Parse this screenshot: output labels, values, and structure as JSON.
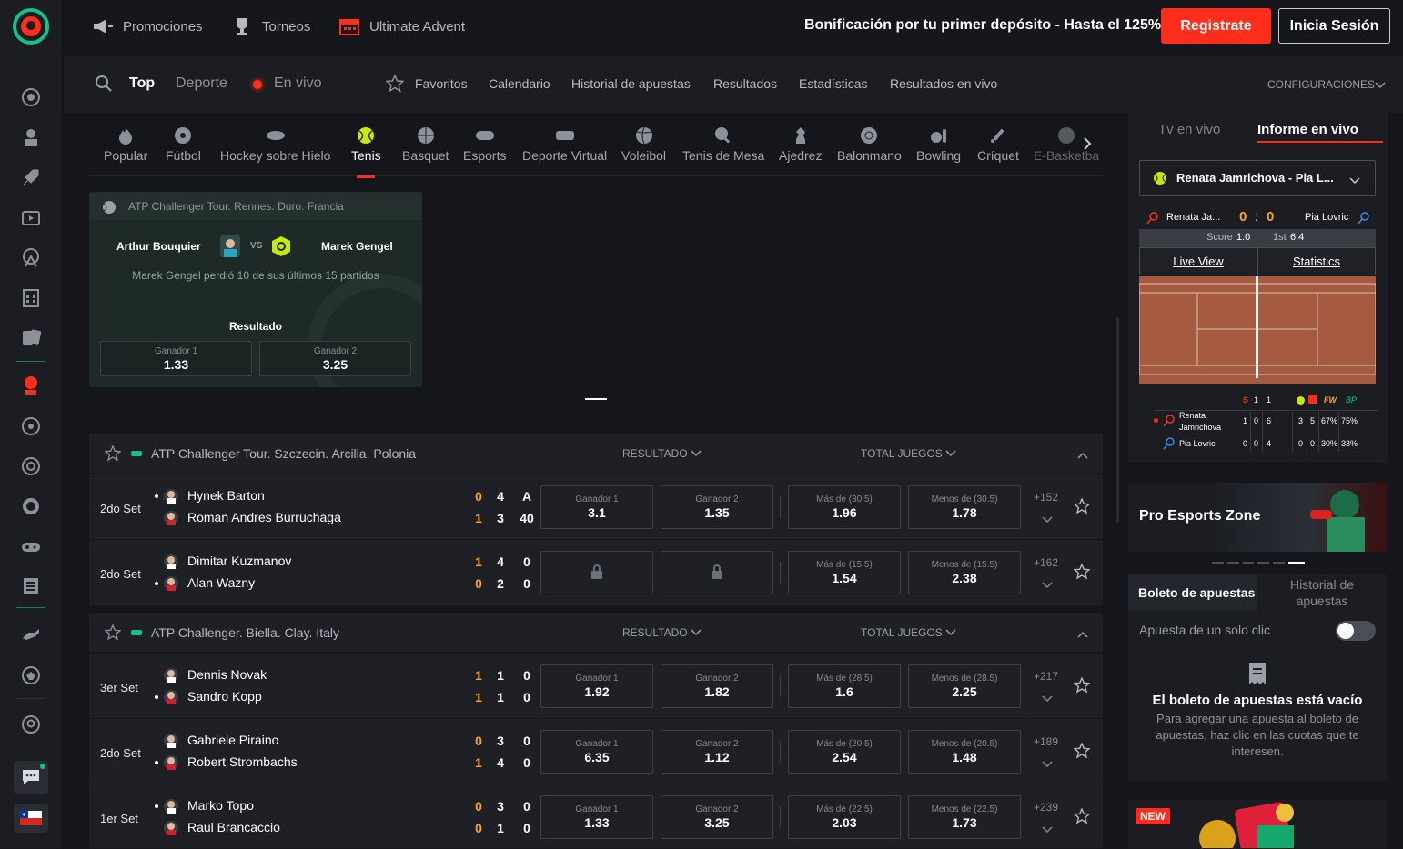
{
  "topbar": {
    "promociones": "Promociones",
    "torneos": "Torneos",
    "advent": "Ultimate Advent",
    "bonus": "Bonificación por tu primer depósito - Hasta el 125%",
    "register": "Registrate",
    "login": "Inicia Sesión"
  },
  "navbar": {
    "top": "Top",
    "deporte": "Deporte",
    "envivo": "En vivo",
    "favoritos": "Favoritos",
    "calendario": "Calendario",
    "historial": "Historial de apuestas",
    "resultados": "Resultados",
    "estadisticas": "Estadísticas",
    "resultados_vivo": "Resultados en vivo",
    "config": "CONFIGURACIONES"
  },
  "sports": [
    "Popular",
    "Fútbol",
    "Hockey sobre Hielo",
    "Tenis",
    "Basquet",
    "Esports",
    "Deporte Virtual",
    "Voleibol",
    "Tenis de Mesa",
    "Ajedrez",
    "Balonmano",
    "Bowling",
    "Críquet",
    "E-Basketba"
  ],
  "featured": {
    "header": "ATP Challenger Tour. Rennes. Duro. Francia",
    "p1": "Arthur Bouquier",
    "p2": "Marek Gengel",
    "vs": "VS",
    "info": "Marek Gengel perdió 10 de sus últimos 15 partidos",
    "result_label": "Resultado",
    "o1_label": "Ganador 1",
    "o1": "1.33",
    "o2_label": "Ganador 2",
    "o2": "3.25"
  },
  "labels": {
    "resultado": "RESULTADO",
    "total": "TOTAL JUEGOS",
    "g1": "Ganador 1",
    "g2": "Ganador 2"
  },
  "comps": [
    {
      "title": "ATP Challenger Tour. Szczecin. Arcilla. Polonia",
      "matches": [
        {
          "set": "2do Set",
          "p1": "Hynek Barton",
          "p2": "Roman Andres Burruchaga",
          "s1": [
            "0",
            "4",
            "A"
          ],
          "s2": [
            "1",
            "3",
            "40"
          ],
          "locked": false,
          "g1": "3.1",
          "g2": "1.35",
          "ml": "Más de (30.5)",
          "mv": "1.96",
          "nl": "Menos de (30.5)",
          "nv": "1.78",
          "more": "+152",
          "serve": 1
        },
        {
          "set": "2do Set",
          "p1": "Dimitar Kuzmanov",
          "p2": "Alan Wazny",
          "s1": [
            "1",
            "4",
            "0"
          ],
          "s2": [
            "0",
            "2",
            "0"
          ],
          "locked": true,
          "g1": "",
          "g2": "",
          "ml": "Más de (15.5)",
          "mv": "1.54",
          "nl": "Menos de (15.5)",
          "nv": "2.38",
          "more": "+162",
          "serve": 2
        }
      ]
    },
    {
      "title": "ATP Challenger. Biella. Clay. Italy",
      "matches": [
        {
          "set": "3er Set",
          "p1": "Dennis Novak",
          "p2": "Sandro Kopp",
          "s1": [
            "1",
            "1",
            "0"
          ],
          "s2": [
            "1",
            "1",
            "0"
          ],
          "locked": false,
          "g1": "1.92",
          "g2": "1.82",
          "ml": "Más de (28.5)",
          "mv": "1.6",
          "nl": "Menos de (28.5)",
          "nv": "2.25",
          "more": "+217",
          "serve": 2
        },
        {
          "set": "2do Set",
          "p1": "Gabriele Piraino",
          "p2": "Robert Strombachs",
          "s1": [
            "0",
            "3",
            "0"
          ],
          "s2": [
            "1",
            "4",
            "0"
          ],
          "locked": false,
          "g1": "6.35",
          "g2": "1.12",
          "ml": "Más de (20.5)",
          "mv": "2.54",
          "nl": "Menos de (20.5)",
          "nv": "1.48",
          "more": "+189",
          "serve": 2
        },
        {
          "set": "1er Set",
          "p1": "Marko Topo",
          "p2": "Raul Brancaccio",
          "s1": [
            "0",
            "3",
            "0"
          ],
          "s2": [
            "0",
            "1",
            "0"
          ],
          "locked": false,
          "g1": "1.33",
          "g2": "3.25",
          "ml": "Más de (22.5)",
          "mv": "2.03",
          "nl": "Menos de (22.5)",
          "nv": "1.73",
          "more": "+239",
          "serve": 1
        }
      ]
    }
  ],
  "rpanel": {
    "tab1": "Tv en vivo",
    "tab2": "Informe en vivo",
    "match": "Renata Jamrichova - Pia L...",
    "p1short": "Renata Ja...",
    "p1score": "0",
    "colon": ":",
    "p2score": "0",
    "p2": "Pia Lovric",
    "score_label": "Score",
    "score_val": "1:0",
    "set_label": "1st",
    "set_val": "6:4",
    "live_view": "Live View",
    "statistics": "Statistics",
    "h_s": "S",
    "h_1": "1",
    "h_1b": "1",
    "h_fw": "FW",
    "h_bp": "BP",
    "r1_name1": "Renata",
    "r1_name2": "Jamrichova",
    "r1": [
      "1",
      "0",
      "6",
      "3",
      "5",
      "67%",
      "75%"
    ],
    "r2_name": "Pia Lovric",
    "r2": [
      "0",
      "0",
      "4",
      "0",
      "0",
      "30%",
      "33%"
    ]
  },
  "promo": {
    "title": "Pro Esports Zone"
  },
  "betslip": {
    "tab1": "Boleto de apuestas",
    "tab2a": "Historial de",
    "tab2b": "apuestas",
    "oneclick": "Apuesta de un solo clic",
    "empty_title": "El boleto de apuestas está vacío",
    "empty_text": "Para agregar una apuesta al boleto de apuestas, haz clic en las cuotas que te interesen."
  },
  "newbadge": "NEW",
  "colors": {
    "accent": "#ff2d1a",
    "green": "#11c58a",
    "tennis": "#c6e80e"
  }
}
